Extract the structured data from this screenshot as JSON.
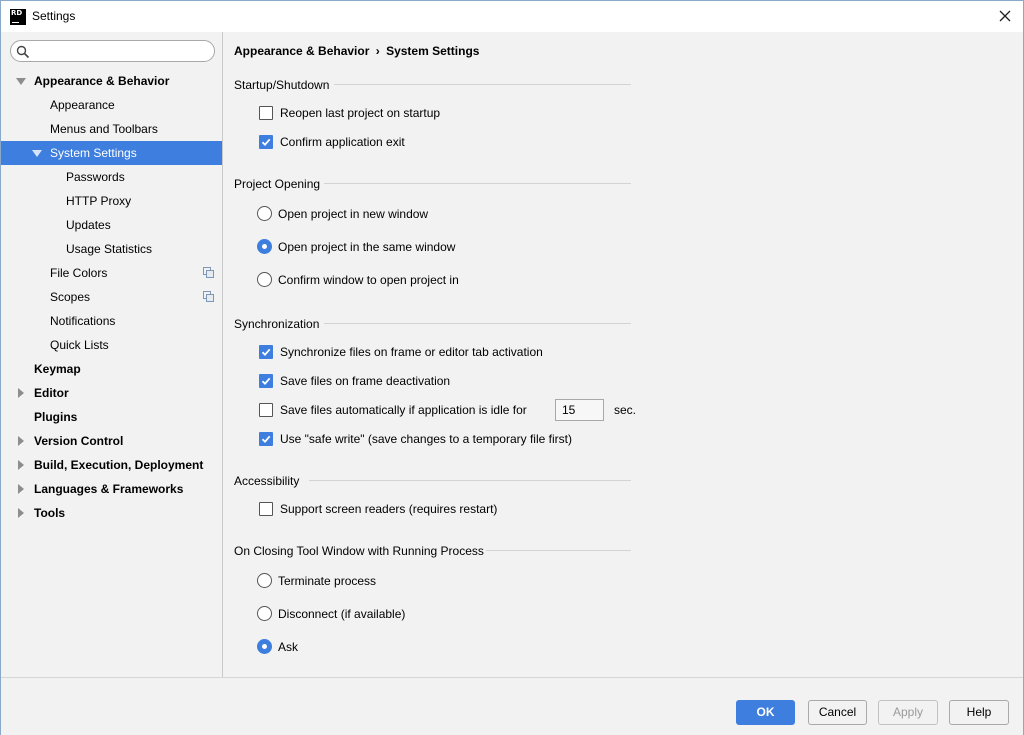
{
  "window": {
    "title": "Settings",
    "icon_label": "RD"
  },
  "search": {
    "placeholder": "",
    "value": ""
  },
  "sidebar": {
    "items": [
      {
        "label": "Appearance & Behavior",
        "level": 0,
        "bold": true,
        "expander": "expanded"
      },
      {
        "label": "Appearance",
        "level": 1
      },
      {
        "label": "Menus and Toolbars",
        "level": 1
      },
      {
        "label": "System Settings",
        "level": 1,
        "selected": true,
        "expander": "expanded"
      },
      {
        "label": "Passwords",
        "level": 2
      },
      {
        "label": "HTTP Proxy",
        "level": 2
      },
      {
        "label": "Updates",
        "level": 2
      },
      {
        "label": "Usage Statistics",
        "level": 2
      },
      {
        "label": "File Colors",
        "level": 1,
        "copy_icon": true
      },
      {
        "label": "Scopes",
        "level": 1,
        "copy_icon": true
      },
      {
        "label": "Notifications",
        "level": 1
      },
      {
        "label": "Quick Lists",
        "level": 1
      },
      {
        "label": "Keymap",
        "level": 0,
        "bold": true
      },
      {
        "label": "Editor",
        "level": 0,
        "bold": true,
        "expander": "collapsed"
      },
      {
        "label": "Plugins",
        "level": 0,
        "bold": true
      },
      {
        "label": "Version Control",
        "level": 0,
        "bold": true,
        "expander": "collapsed"
      },
      {
        "label": "Build, Execution, Deployment",
        "level": 0,
        "bold": true,
        "expander": "collapsed"
      },
      {
        "label": "Languages & Frameworks",
        "level": 0,
        "bold": true,
        "expander": "collapsed"
      },
      {
        "label": "Tools",
        "level": 0,
        "bold": true,
        "expander": "collapsed"
      }
    ]
  },
  "content": {
    "breadcrumb": {
      "parent": "Appearance & Behavior",
      "separator": "›",
      "current": "System Settings"
    },
    "startup": {
      "title": "Startup/Shutdown",
      "reopen_last": {
        "label": "Reopen last project on startup",
        "checked": false
      },
      "confirm_exit": {
        "label": "Confirm application exit",
        "checked": true
      }
    },
    "project_opening": {
      "title": "Project Opening",
      "options": [
        {
          "label": "Open project in new window",
          "selected": false
        },
        {
          "label": "Open project in the same window",
          "selected": true
        },
        {
          "label": "Confirm window to open project in",
          "selected": false
        }
      ]
    },
    "sync": {
      "title": "Synchronization",
      "sync_files": {
        "label": "Synchronize files on frame or editor tab activation",
        "checked": true
      },
      "save_on_deactivation": {
        "label": "Save files on frame deactivation",
        "checked": true
      },
      "save_idle": {
        "label": "Save files automatically if application is idle for",
        "checked": false,
        "value": "15",
        "unit": "sec."
      },
      "safe_write": {
        "label": "Use \"safe write\" (save changes to a temporary file first)",
        "checked": true
      }
    },
    "accessibility": {
      "title": "Accessibility",
      "screen_readers": {
        "label": "Support screen readers (requires restart)",
        "checked": false
      }
    },
    "closing": {
      "title": "On Closing Tool Window with Running Process",
      "options": [
        {
          "label": "Terminate process",
          "selected": false
        },
        {
          "label": "Disconnect (if available)",
          "selected": false
        },
        {
          "label": "Ask",
          "selected": true
        }
      ]
    }
  },
  "footer": {
    "ok": "OK",
    "cancel": "Cancel",
    "apply": "Apply",
    "help": "Help"
  },
  "colors": {
    "accent": "#3d7ede",
    "background": "#f2f2f2"
  }
}
